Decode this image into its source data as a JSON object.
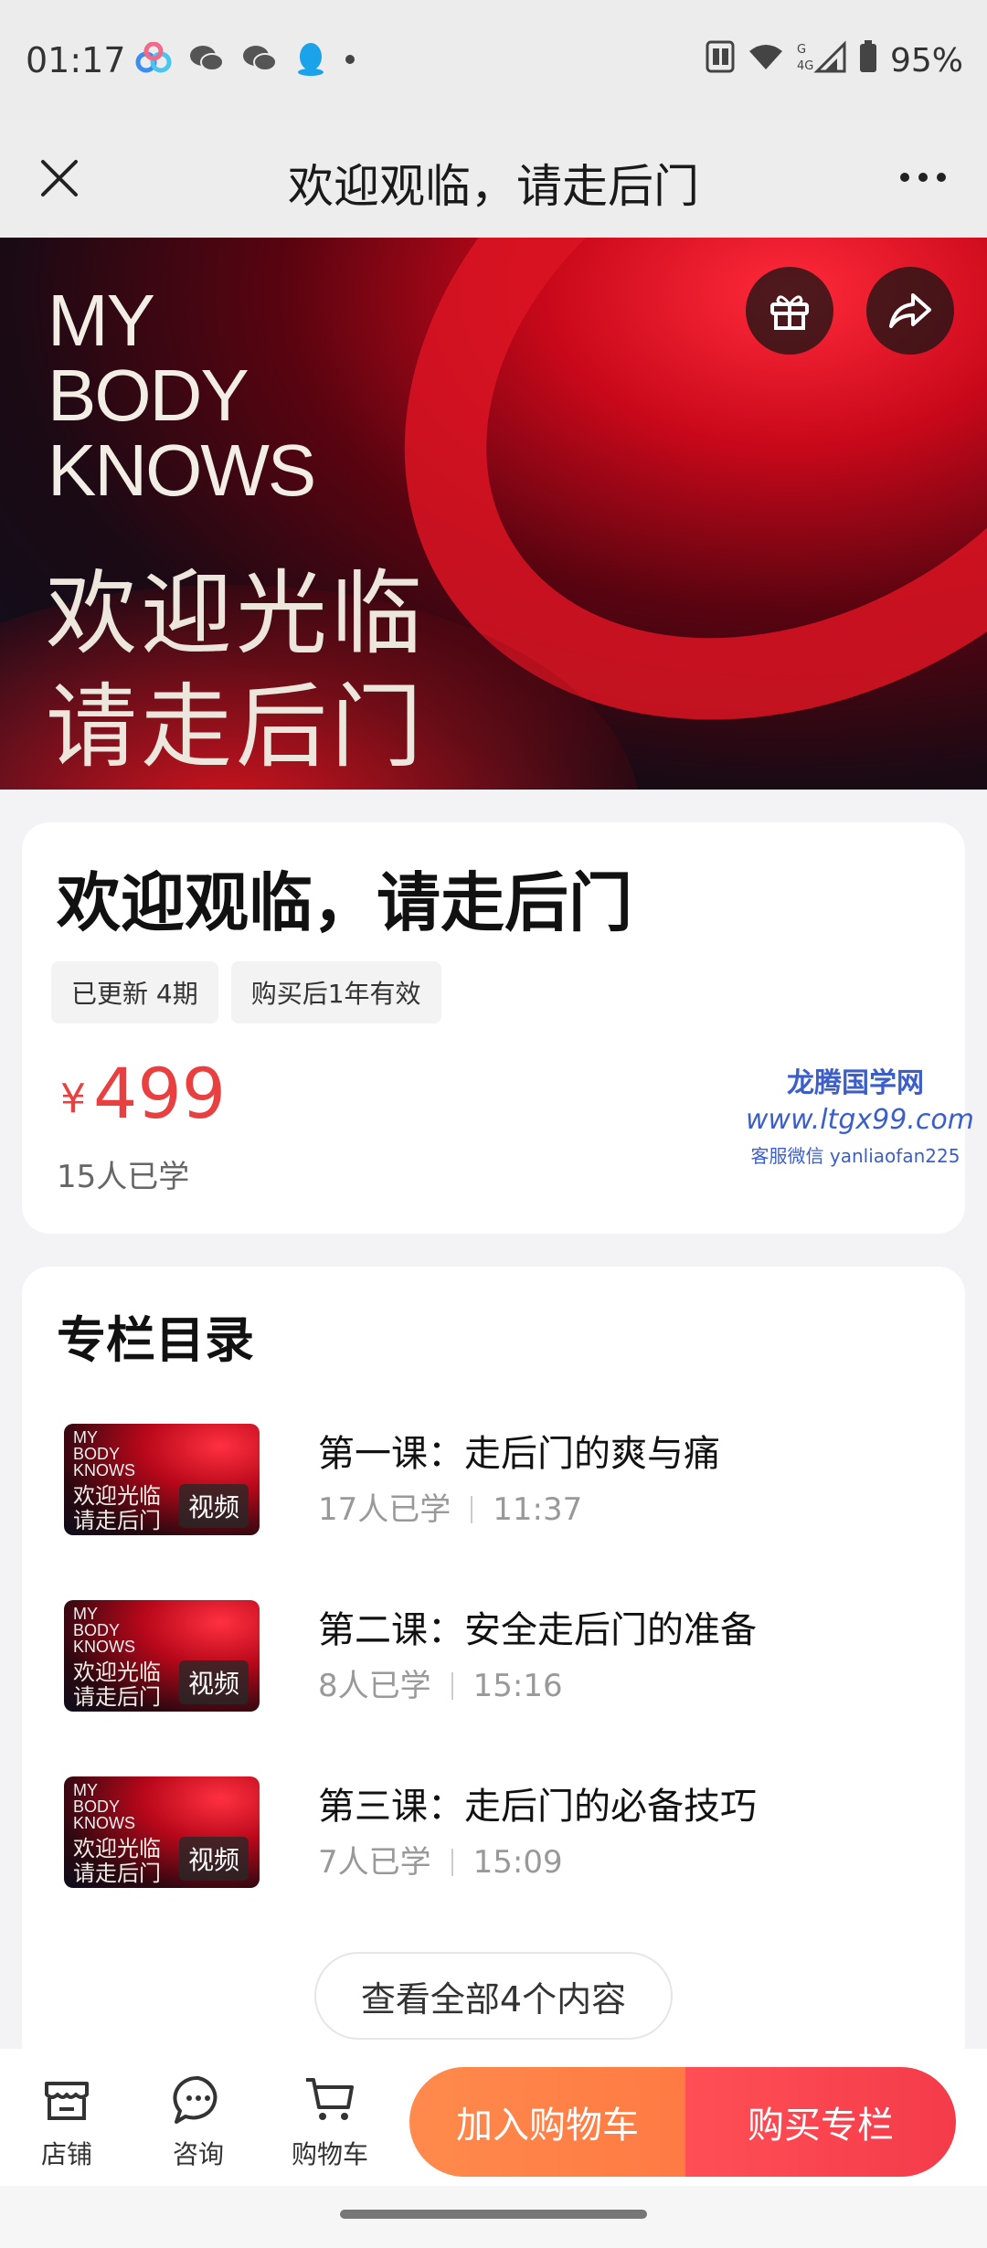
{
  "status_bar": {
    "time": "01:17",
    "battery": "95%",
    "network": "4G",
    "icons": [
      "baidu-netdisk-icon",
      "wechat-icon",
      "wechat-icon",
      "qq-icon",
      "dot-icon",
      "nfc-icon",
      "wifi-icon",
      "signal-icon",
      "battery-icon"
    ]
  },
  "header": {
    "title": "欢迎观临，请走后门",
    "close_icon": "close-icon",
    "more_icon": "more-icon"
  },
  "hero": {
    "brand_lines": [
      "MY",
      "BODY",
      "KNOWS"
    ],
    "text_lines": [
      "欢迎光临",
      "请走后门"
    ],
    "buttons": [
      "gift-icon",
      "share-icon"
    ]
  },
  "course": {
    "title": "欢迎观临，请走后门",
    "tags": [
      "已更新 4期",
      "购买后1年有效"
    ],
    "currency": "¥",
    "price": "499",
    "learners": "15人已学"
  },
  "watermark": {
    "line1": "龙腾国学网",
    "line2": "www.ltgx99.com",
    "line3": "客服微信 yanliaofan225"
  },
  "catalog": {
    "title": "专栏目录",
    "lessons": [
      {
        "title": "第一课：走后门的爽与痛",
        "learners": "17人已学",
        "duration": "11:37",
        "badge": "视频",
        "thumb_brand": [
          "MY",
          "BODY",
          "KNOWS"
        ],
        "thumb_text": [
          "欢迎光临",
          "请走后门"
        ]
      },
      {
        "title": "第二课：安全走后门的准备",
        "learners": "8人已学",
        "duration": "15:16",
        "badge": "视频",
        "thumb_brand": [
          "MY",
          "BODY",
          "KNOWS"
        ],
        "thumb_text": [
          "欢迎光临",
          "请走后门"
        ]
      },
      {
        "title": "第三课：走后门的必备技巧",
        "learners": "7人已学",
        "duration": "15:09",
        "badge": "视频",
        "thumb_brand": [
          "MY",
          "BODY",
          "KNOWS"
        ],
        "thumb_text": [
          "欢迎光临",
          "请走后门"
        ]
      }
    ],
    "view_all": "查看全部4个内容"
  },
  "bottom_bar": {
    "tabs": [
      {
        "label": "店铺",
        "icon": "store-icon"
      },
      {
        "label": "咨询",
        "icon": "chat-icon"
      },
      {
        "label": "购物车",
        "icon": "cart-icon"
      }
    ],
    "add_to_cart": "加入购物车",
    "buy": "购买专栏"
  },
  "colors": {
    "price": "#e84040",
    "add_to_cart": "#ff8a4c",
    "buy": "#f43b4a",
    "watermark": "#3c5ec9"
  }
}
